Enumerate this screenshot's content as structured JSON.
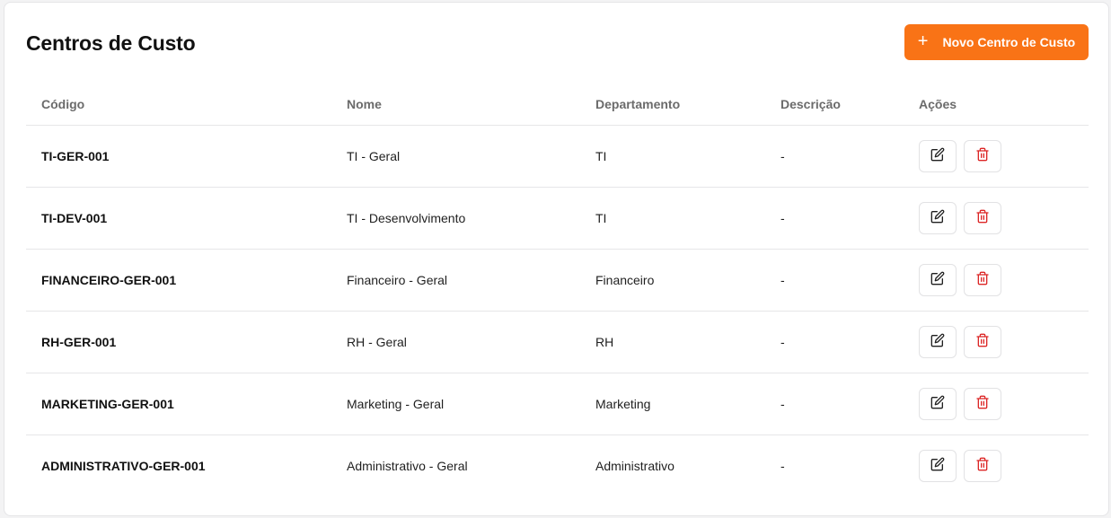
{
  "page": {
    "title": "Centros de Custo",
    "new_button_label": "Novo Centro de Custo",
    "new_button_icon": "plus-icon",
    "accent_color": "#f97316",
    "delete_color": "#dc2626"
  },
  "table": {
    "headers": [
      "Código",
      "Nome",
      "Departamento",
      "Descrição",
      "Ações"
    ],
    "rows": [
      {
        "code": "TI-GER-001",
        "name": "TI - Geral",
        "department": "TI",
        "description": "-"
      },
      {
        "code": "TI-DEV-001",
        "name": "TI - Desenvolvimento",
        "department": "TI",
        "description": "-"
      },
      {
        "code": "FINANCEIRO-GER-001",
        "name": "Financeiro - Geral",
        "department": "Financeiro",
        "description": "-"
      },
      {
        "code": "RH-GER-001",
        "name": "RH - Geral",
        "department": "RH",
        "description": "-"
      },
      {
        "code": "MARKETING-GER-001",
        "name": "Marketing - Geral",
        "department": "Marketing",
        "description": "-"
      },
      {
        "code": "ADMINISTRATIVO-GER-001",
        "name": "Administrativo - Geral",
        "department": "Administrativo",
        "description": "-"
      }
    ],
    "row_actions": [
      {
        "icon": "edit-icon"
      },
      {
        "icon": "trash-icon"
      }
    ]
  }
}
